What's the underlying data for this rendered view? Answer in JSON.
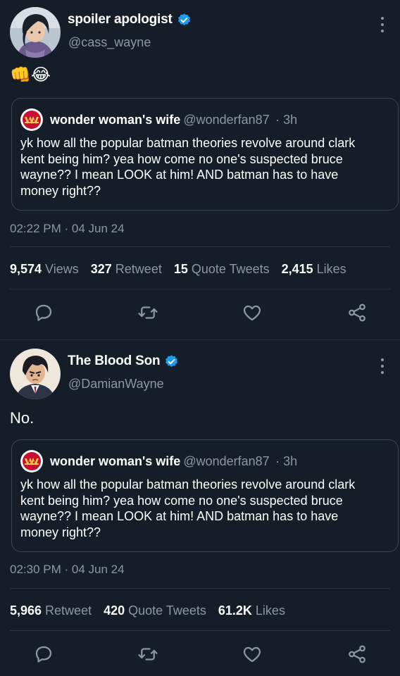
{
  "tweets": [
    {
      "name": "spoiler apologist",
      "handle": "@cass_wayne",
      "text": "👊😂",
      "quote": {
        "name": "wonder woman's wife",
        "handle": "@wonderfan87",
        "age": "· 3h",
        "text": "yk how all the popular batman theories revolve around clark kent being him? yea how come no one's suspected bruce wayne?? I mean LOOK at him! AND batman has to have money right??"
      },
      "timestamp": "02:22 PM · 04 Jun 24",
      "stats": [
        {
          "num": "9,574",
          "label": "Views"
        },
        {
          "num": "327",
          "label": "Retweet"
        },
        {
          "num": "15",
          "label": "Quote Tweets"
        },
        {
          "num": "2,415",
          "label": "Likes"
        }
      ]
    },
    {
      "name": "The Blood Son",
      "handle": "@DamianWayne",
      "text": "No.",
      "quote": {
        "name": "wonder woman's wife",
        "handle": "@wonderfan87",
        "age": "· 3h",
        "text": "yk how all the popular batman theories revolve around clark kent being him? yea how come no one's suspected bruce wayne?? I mean LOOK at him! AND batman has to have money right??"
      },
      "timestamp": "02:30 PM · 04 Jun 24",
      "stats": [
        {
          "num": "5,966",
          "label": "Retweet"
        },
        {
          "num": "420",
          "label": "Quote Tweets"
        },
        {
          "num": "61.2K",
          "label": "Likes"
        }
      ]
    }
  ],
  "colors": {
    "background": "#151d29",
    "secondary_text": "#8b97a4",
    "verified_blue": "#1d9bf0",
    "border": "#3a4552"
  },
  "icons": [
    "reply-icon",
    "retweet-icon",
    "like-icon",
    "share-icon",
    "more-icon",
    "verified-badge-icon"
  ]
}
